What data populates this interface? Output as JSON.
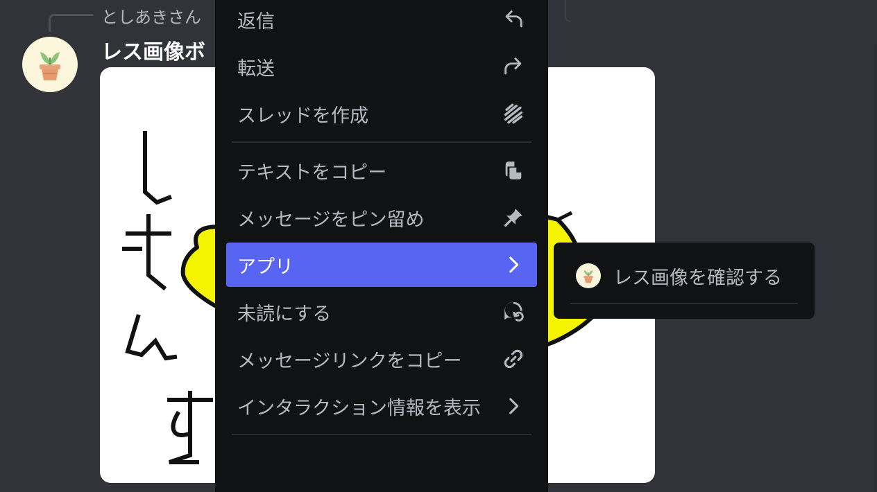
{
  "chat": {
    "reply_author": "としあきさん",
    "message_text": "レス画像ボ"
  },
  "menu": {
    "items": [
      {
        "label": "返信",
        "icon": "reply-icon"
      },
      {
        "label": "転送",
        "icon": "forward-icon"
      },
      {
        "label": "スレッドを作成",
        "icon": "threads-icon"
      },
      {
        "label": "テキストをコピー",
        "icon": "copy-icon"
      },
      {
        "label": "メッセージをピン留め",
        "icon": "pin-icon"
      },
      {
        "label": "アプリ",
        "icon": "chevron-right-icon",
        "active": true
      },
      {
        "label": "未読にする",
        "icon": "mark-unread-icon"
      },
      {
        "label": "メッセージリンクをコピー",
        "icon": "link-icon"
      },
      {
        "label": "インタラクション情報を表示",
        "icon": "chevron-right-icon"
      }
    ]
  },
  "submenu": {
    "items": [
      {
        "label": "レス画像を確認する",
        "icon": "app-avatar"
      }
    ]
  },
  "colors": {
    "background": "#313338",
    "menu_bg": "#111214",
    "accent": "#5865f2",
    "menu_text": "#b5bac1"
  }
}
